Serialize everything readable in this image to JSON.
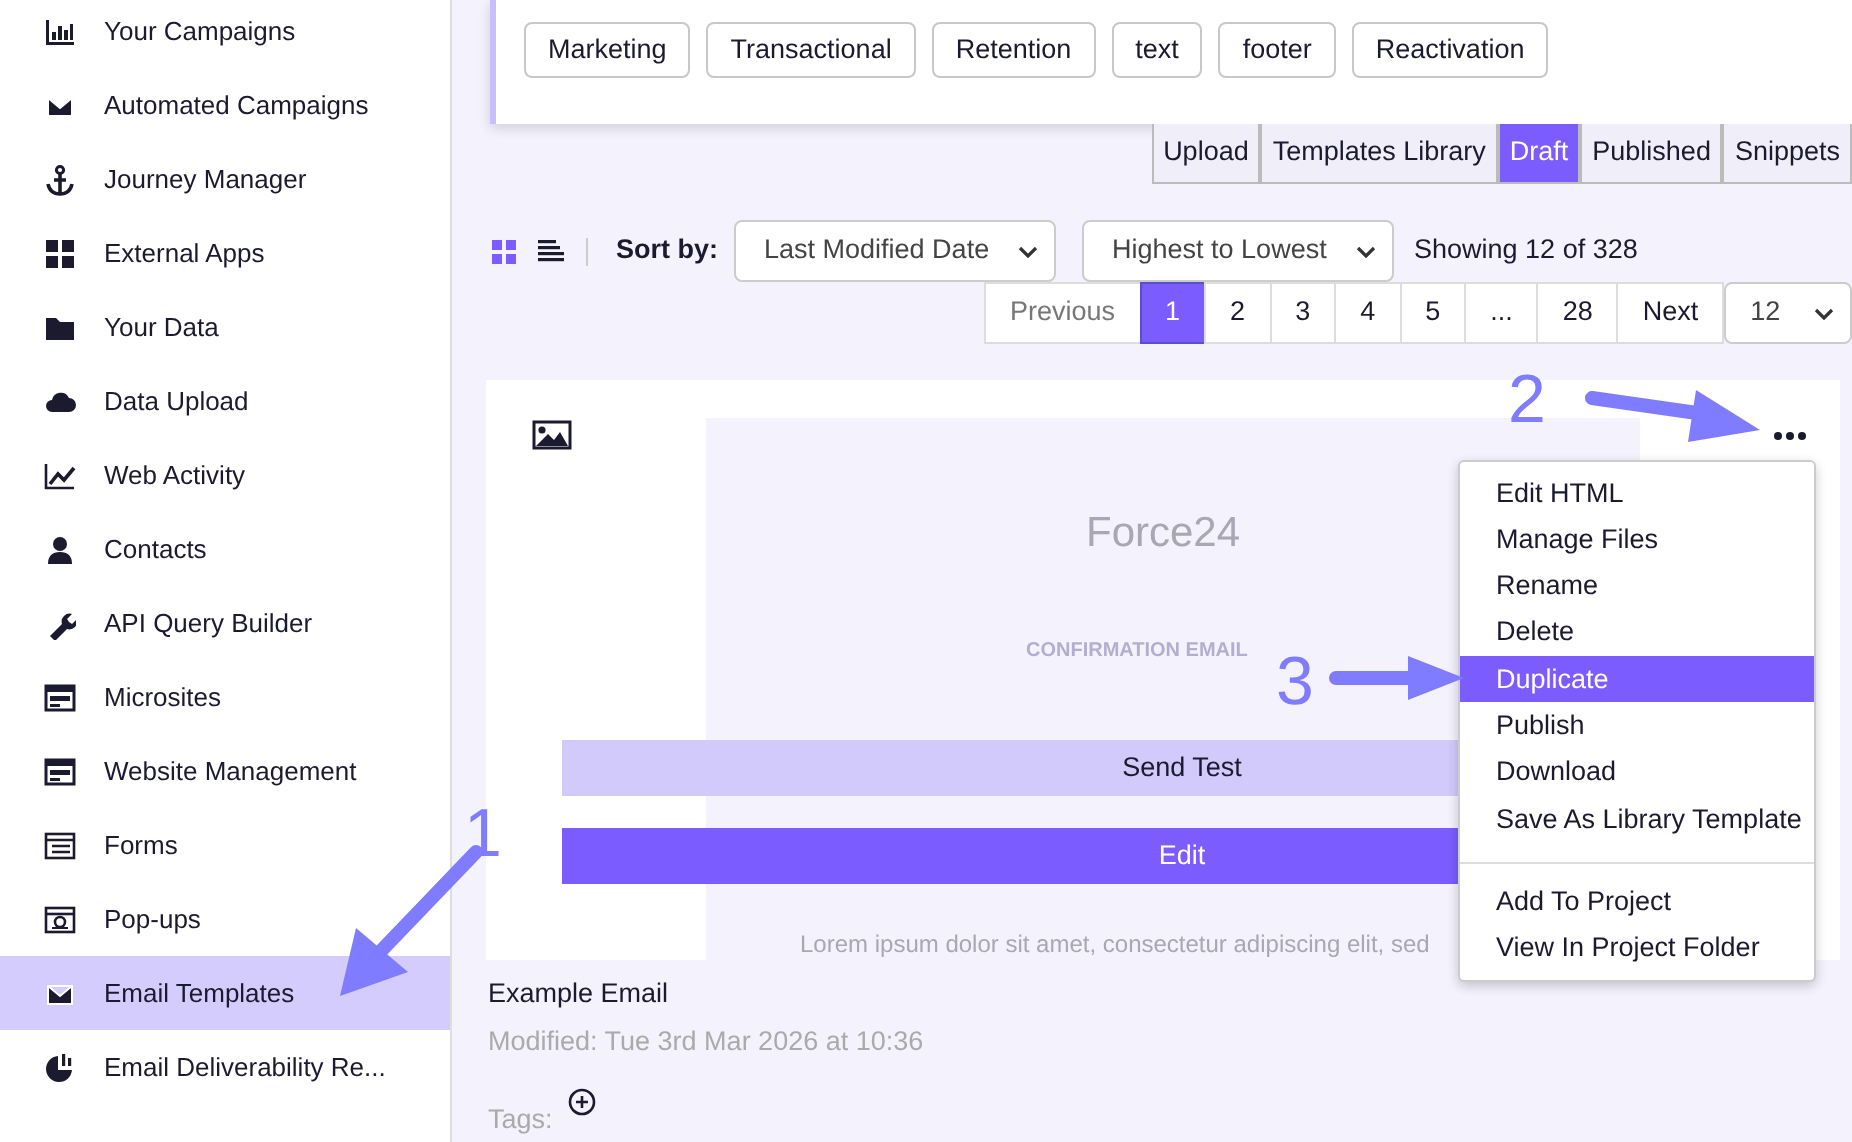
{
  "sidebar": {
    "items": [
      {
        "label": "Your Campaigns",
        "selected": false
      },
      {
        "label": "Automated Campaigns",
        "selected": false
      },
      {
        "label": "Journey Manager",
        "selected": false
      },
      {
        "label": "External Apps",
        "selected": false
      },
      {
        "label": "Your Data",
        "selected": false
      },
      {
        "label": "Data Upload",
        "selected": false
      },
      {
        "label": "Web Activity",
        "selected": false
      },
      {
        "label": "Contacts",
        "selected": false
      },
      {
        "label": "API Query Builder",
        "selected": false
      },
      {
        "label": "Microsites",
        "selected": false
      },
      {
        "label": "Website Management",
        "selected": false
      },
      {
        "label": "Forms",
        "selected": false
      },
      {
        "label": "Pop-ups",
        "selected": false
      },
      {
        "label": "Email Templates",
        "selected": true
      },
      {
        "label": "Email Deliverability Re...",
        "selected": false
      }
    ]
  },
  "tag_filters": [
    "Marketing",
    "Transactional",
    "Retention",
    "text",
    "footer",
    "Reactivation"
  ],
  "tabs": [
    {
      "label": "Upload",
      "selected": false
    },
    {
      "label": "Templates Library",
      "selected": false
    },
    {
      "label": "Draft",
      "selected": true
    },
    {
      "label": "Published",
      "selected": false
    },
    {
      "label": "Snippets",
      "selected": false
    }
  ],
  "toolbar": {
    "views": [
      {
        "kind": "grid",
        "selected": true
      },
      {
        "kind": "list",
        "selected": false
      }
    ],
    "sort_label": "Sort by:",
    "sort_field": "Last Modified Date",
    "sort_order": "Highest to Lowest",
    "count": "Showing 12 of 328"
  },
  "pagination": {
    "pages": [
      {
        "label": "Previous",
        "selected": false,
        "disabled": true
      },
      {
        "label": "1",
        "selected": true,
        "disabled": false
      },
      {
        "label": "2",
        "selected": false,
        "disabled": false
      },
      {
        "label": "3",
        "selected": false,
        "disabled": false
      },
      {
        "label": "4",
        "selected": false,
        "disabled": false
      },
      {
        "label": "5",
        "selected": false,
        "disabled": false
      },
      {
        "label": "...",
        "selected": false,
        "disabled": false
      },
      {
        "label": "28",
        "selected": false,
        "disabled": false
      },
      {
        "label": "Next",
        "selected": false,
        "disabled": false
      }
    ],
    "per_page": "12"
  },
  "template": {
    "preview": {
      "logo": "Force24",
      "eyebrow": "CONFIRMATION EMAIL",
      "body": "Lorem ipsum dolor sit amet, consectetur adipiscing elit, sed"
    },
    "buttons": [
      {
        "label": "Send Test",
        "kind": "secondary"
      },
      {
        "label": "Edit",
        "kind": "primary"
      }
    ],
    "name": "Example Email",
    "modified": "Modified: Tue 3rd Mar 2026 at 10:36",
    "tags_label": "Tags:"
  },
  "menu": {
    "items": [
      {
        "label": "Edit HTML",
        "selected": false,
        "kind": "item"
      },
      {
        "label": "Manage Files",
        "selected": false,
        "kind": "item"
      },
      {
        "label": "Rename",
        "selected": false,
        "kind": "item"
      },
      {
        "label": "Delete",
        "selected": false,
        "kind": "item"
      },
      {
        "label": "Duplicate",
        "selected": true,
        "kind": "item"
      },
      {
        "label": "Publish",
        "selected": false,
        "kind": "item"
      },
      {
        "label": "Download",
        "selected": false,
        "kind": "item"
      },
      {
        "label": "Save As Library Template",
        "selected": false,
        "kind": "item"
      },
      {
        "kind": "divider"
      },
      {
        "label": "Add To Project",
        "selected": false,
        "kind": "item"
      },
      {
        "label": "View In Project Folder",
        "selected": false,
        "kind": "item"
      }
    ]
  },
  "annotations": [
    {
      "label": "1"
    },
    {
      "label": "2"
    },
    {
      "label": "3"
    }
  ]
}
